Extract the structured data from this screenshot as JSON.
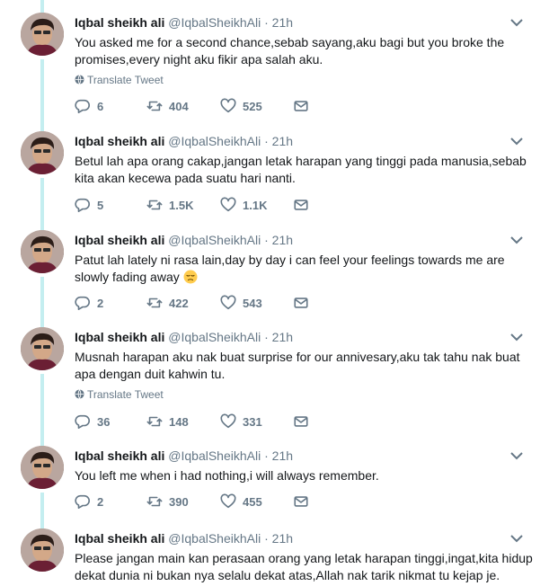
{
  "colors": {
    "thread_line": "#c4eef0",
    "text": "#14171a",
    "muted": "#657786"
  },
  "icons": {
    "reply": "reply-icon",
    "retweet": "retweet-icon",
    "like": "heart-icon",
    "message": "envelope-icon",
    "translate": "globe-icon",
    "caret": "chevron-down-icon"
  },
  "tweets": [
    {
      "name": "Iqbal sheikh ali",
      "handle": "@IqbalSheikhAli",
      "separator": "·",
      "time": "21h",
      "text": "You asked me for a second chance,sebab sayang,aku bagi but you broke the promises,every night aku fikir apa salah aku.",
      "translate": "Translate Tweet",
      "replies": "6",
      "retweets": "404",
      "likes": "525"
    },
    {
      "name": "Iqbal sheikh ali",
      "handle": "@IqbalSheikhAli",
      "separator": "·",
      "time": "21h",
      "text": "Betul lah apa orang cakap,jangan letak harapan yang tinggi pada manusia,sebab kita akan kecewa pada suatu hari nanti.",
      "replies": "5",
      "retweets": "1.5K",
      "likes": "1.1K"
    },
    {
      "name": "Iqbal sheikh ali",
      "handle": "@IqbalSheikhAli",
      "separator": "·",
      "time": "21h",
      "text": "Patut lah lately ni rasa lain,day by day i can feel your feelings towards me are slowly fading away",
      "emoji": "pensive-face-emoji",
      "replies": "2",
      "retweets": "422",
      "likes": "543"
    },
    {
      "name": "Iqbal sheikh ali",
      "handle": "@IqbalSheikhAli",
      "separator": "·",
      "time": "21h",
      "text": "Musnah harapan aku nak buat surprise for our annivesary,aku tak tahu nak buat apa dengan duit kahwin tu.",
      "translate": "Translate Tweet",
      "replies": "36",
      "retweets": "148",
      "likes": "331"
    },
    {
      "name": "Iqbal sheikh ali",
      "handle": "@IqbalSheikhAli",
      "separator": "·",
      "time": "21h",
      "text": "You left me when i had nothing,i will always remember.",
      "replies": "2",
      "retweets": "390",
      "likes": "455"
    },
    {
      "name": "Iqbal sheikh ali",
      "handle": "@IqbalSheikhAli",
      "separator": "·",
      "time": "21h",
      "text": "Please jangan main kan perasaan orang yang letak harapan tinggi,ingat,kita hidup dekat dunia ni bukan nya selalu dekat atas,Allah nak tarik nikmat tu kejap je."
    }
  ]
}
